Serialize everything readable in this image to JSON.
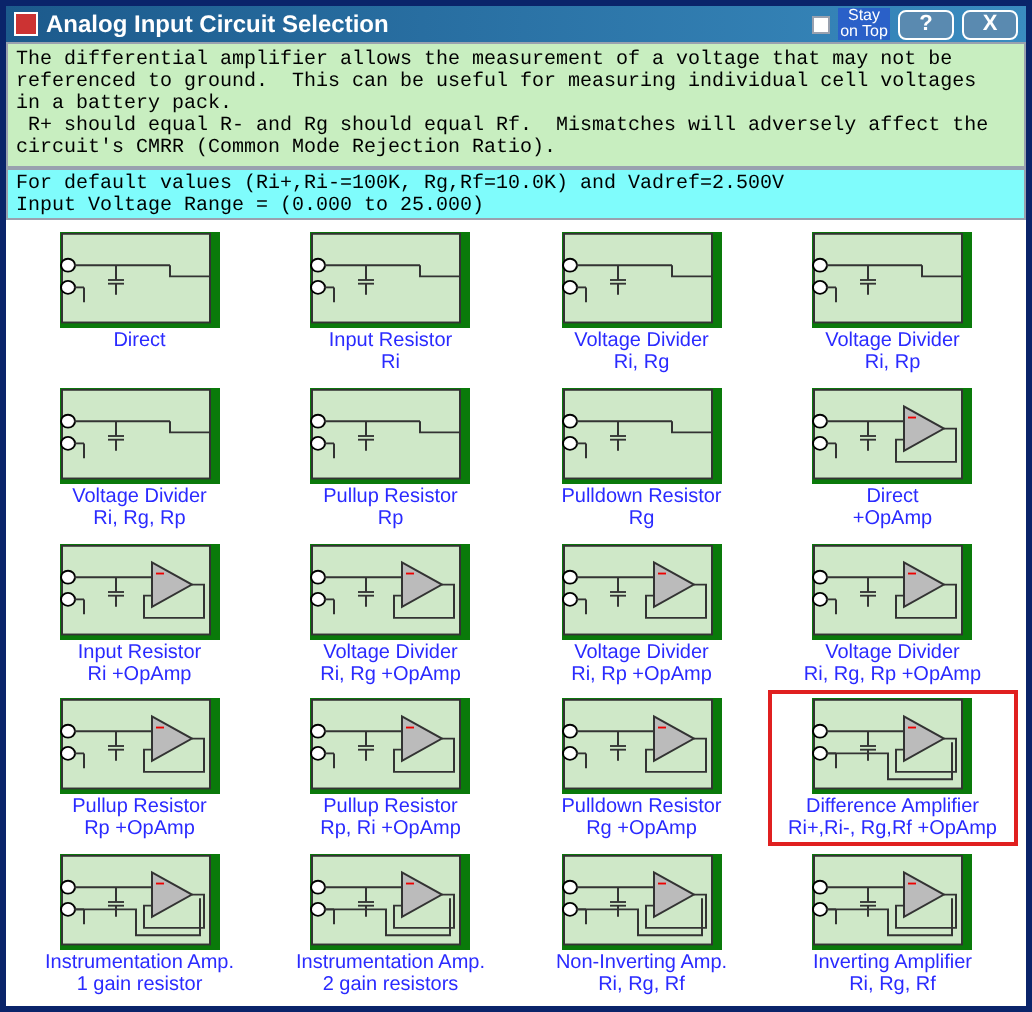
{
  "window": {
    "title": "Analog Input Circuit Selection"
  },
  "title_bar": {
    "stay_on_top": {
      "label": "Stay on Top",
      "checked": false
    },
    "buttons": [
      "?",
      "X"
    ]
  },
  "description": [
    "The differential amplifier allows the measurement of a voltage that may not be",
    "referenced to ground.  This can be useful for measuring individual cell voltages",
    "in a battery pack.",
    " R+ should equal R- and Rg should equal Rf.  Mismatches will adversely affect the",
    "circuit's CMRR (Common Mode Rejection Ratio)."
  ],
  "defaults": [
    "For default values (Ri+,Ri-=100K, Rg,Rf=10.0K) and Vadref=2.500V",
    "Input Voltage Range = (0.000 to 25.000)"
  ],
  "circuits": [
    {
      "lines": [
        "Direct"
      ],
      "kind": "plain",
      "selected": false
    },
    {
      "lines": [
        "Input Resistor",
        "Ri"
      ],
      "kind": "plain",
      "selected": false
    },
    {
      "lines": [
        "Voltage Divider",
        "Ri, Rg"
      ],
      "kind": "plain",
      "selected": false
    },
    {
      "lines": [
        "Voltage Divider",
        "Ri, Rp"
      ],
      "kind": "plain",
      "selected": false
    },
    {
      "lines": [
        "Voltage Divider",
        "Ri, Rg, Rp"
      ],
      "kind": "plain",
      "selected": false
    },
    {
      "lines": [
        "Pullup Resistor",
        "Rp"
      ],
      "kind": "plain",
      "selected": false
    },
    {
      "lines": [
        "Pulldown Resistor",
        "Rg"
      ],
      "kind": "plain",
      "selected": false
    },
    {
      "lines": [
        "Direct",
        "+OpAmp"
      ],
      "kind": "opamp",
      "selected": false
    },
    {
      "lines": [
        "Input Resistor",
        "Ri +OpAmp"
      ],
      "kind": "opamp",
      "selected": false
    },
    {
      "lines": [
        "Voltage Divider",
        "Ri, Rg +OpAmp"
      ],
      "kind": "opamp",
      "selected": false
    },
    {
      "lines": [
        "Voltage Divider",
        "Ri, Rp +OpAmp"
      ],
      "kind": "opamp",
      "selected": false
    },
    {
      "lines": [
        "Voltage Divider",
        "Ri, Rg, Rp +OpAmp"
      ],
      "kind": "opamp",
      "selected": false
    },
    {
      "lines": [
        "Pullup Resistor",
        "Rp +OpAmp"
      ],
      "kind": "opamp",
      "selected": false
    },
    {
      "lines": [
        "Pullup Resistor",
        "Rp, Ri +OpAmp"
      ],
      "kind": "opamp",
      "selected": false
    },
    {
      "lines": [
        "Pulldown Resistor",
        "Rg +OpAmp"
      ],
      "kind": "opamp",
      "selected": false
    },
    {
      "lines": [
        "Difference Amplifier",
        "Ri+,Ri-, Rg,Rf +OpAmp"
      ],
      "kind": "diff",
      "selected": true
    },
    {
      "lines": [
        "Instrumentation Amp.",
        "1 gain resistor"
      ],
      "kind": "diff",
      "selected": false
    },
    {
      "lines": [
        "Instrumentation Amp.",
        "2 gain resistors"
      ],
      "kind": "diff",
      "selected": false
    },
    {
      "lines": [
        "Non-Inverting Amp.",
        "Ri, Rg, Rf"
      ],
      "kind": "diff",
      "selected": false
    },
    {
      "lines": [
        "Inverting Amplifier",
        "Ri, Rg, Rf"
      ],
      "kind": "diff",
      "selected": false
    }
  ]
}
